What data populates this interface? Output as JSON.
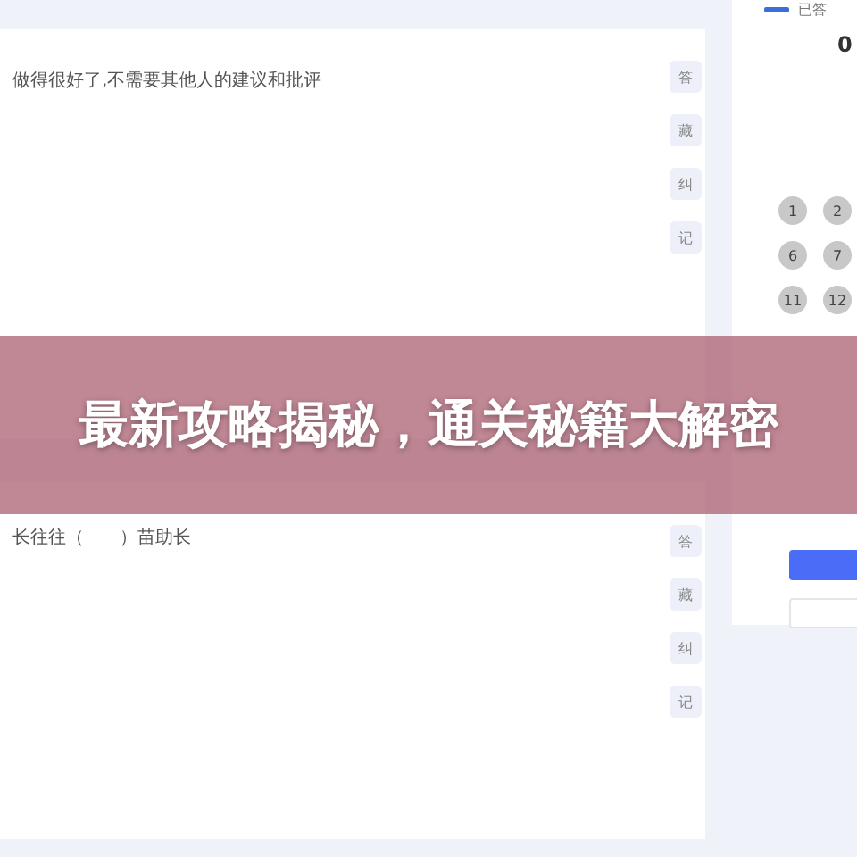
{
  "questions": [
    {
      "text": "做得很好了,不需要其他人的建议和批评",
      "tools": [
        "答",
        "藏",
        "纠",
        "记"
      ]
    },
    {
      "text": "长往往（　　）苗助长",
      "tools": [
        "答",
        "藏",
        "纠",
        "记"
      ]
    }
  ],
  "answer_panel": {
    "legend": "已答",
    "count": "0",
    "numbers": [
      "1",
      "2",
      "6",
      "7",
      "11",
      "12"
    ]
  },
  "banner": {
    "title": "最新攻略揭秘，通关秘籍大解密"
  }
}
